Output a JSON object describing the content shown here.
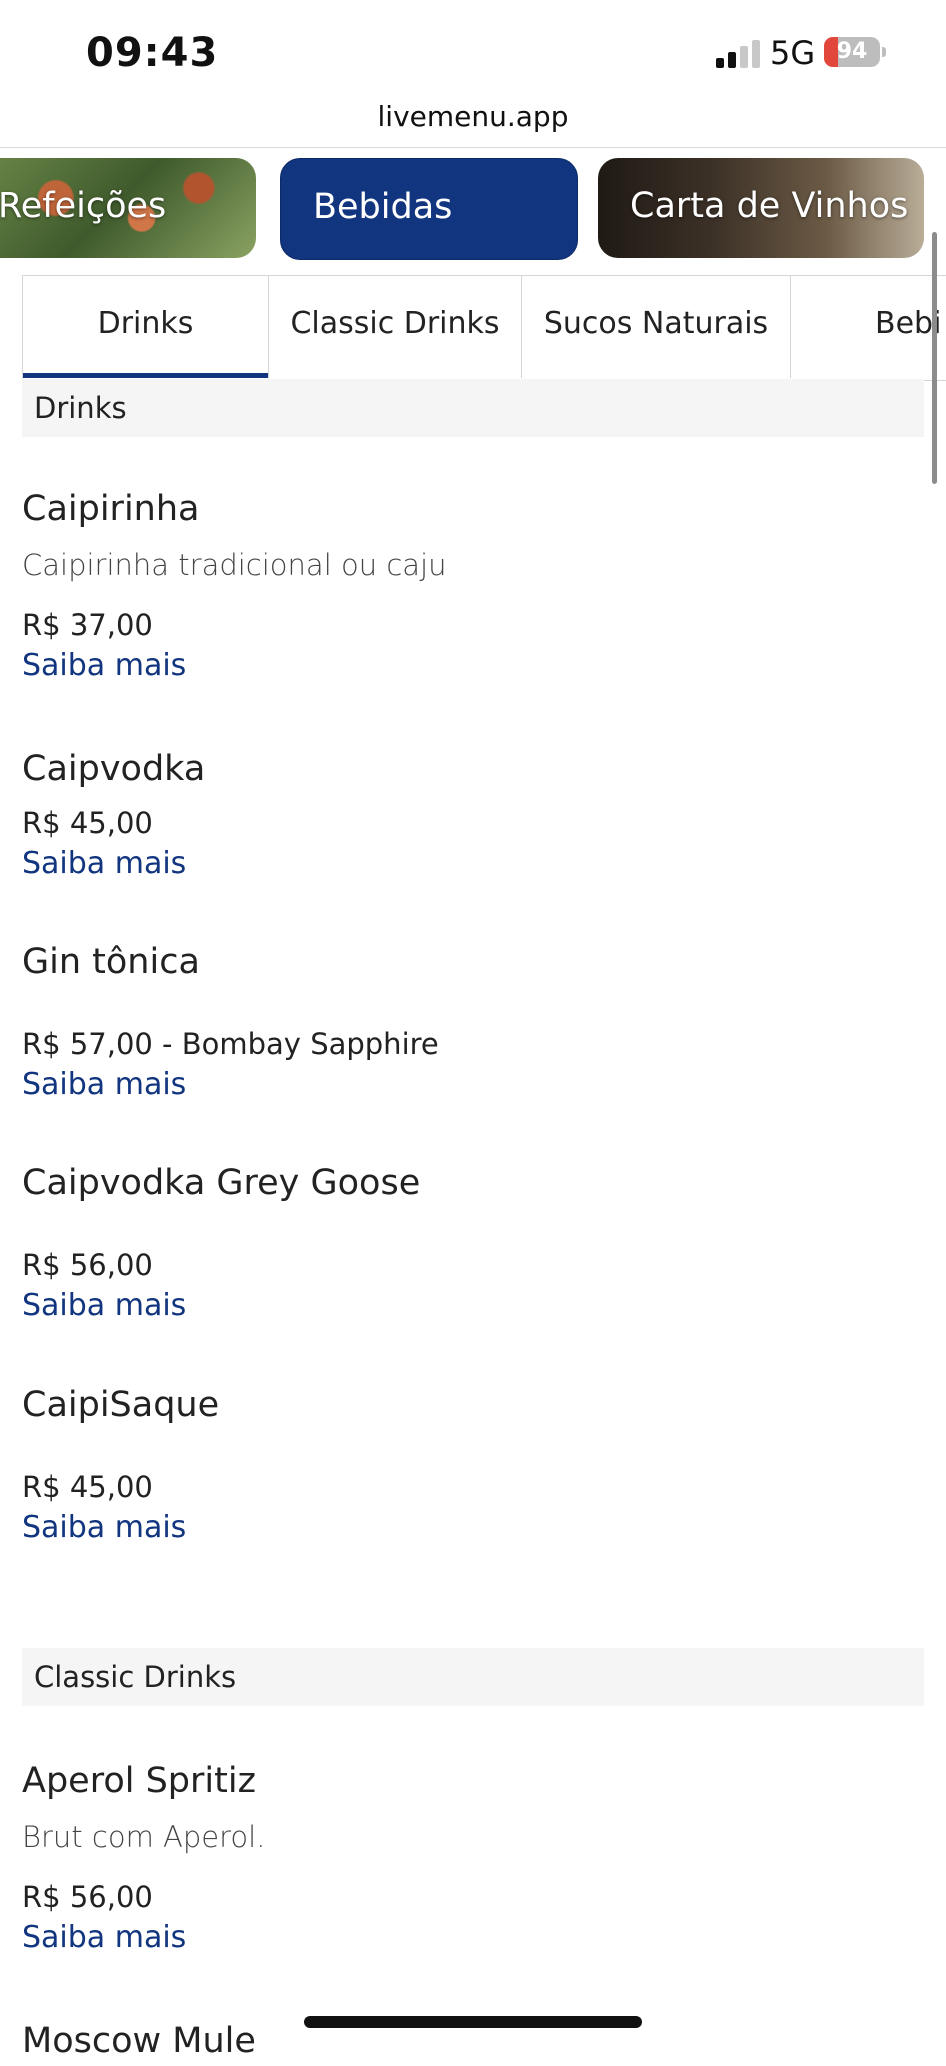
{
  "status_bar": {
    "time": "09:43",
    "network": "5G",
    "battery": "94"
  },
  "browser": {
    "url": "livemenu.app"
  },
  "categories": [
    {
      "label": "Refeições"
    },
    {
      "label": "Bebidas"
    },
    {
      "label": "Carta de Vinhos"
    }
  ],
  "tabs": [
    {
      "label": "Drinks"
    },
    {
      "label": "Classic Drinks"
    },
    {
      "label": "Sucos Naturais"
    },
    {
      "label": "Bebi"
    }
  ],
  "sections": [
    {
      "title": "Drinks",
      "items": [
        {
          "name": "Caipirinha",
          "description": "Caipirinha tradicional ou caju",
          "price": "R$ 37,00",
          "link": "Saiba mais"
        },
        {
          "name": "Caipvodka",
          "price": "R$ 45,00",
          "link": "Saiba mais"
        },
        {
          "name": "Gin tônica",
          "price": "R$ 57,00 - Bombay Sapphire",
          "link": "Saiba mais"
        },
        {
          "name": "Caipvodka Grey Goose",
          "price": "R$ 56,00",
          "link": "Saiba mais"
        },
        {
          "name": "CaipiSaque",
          "price": "R$ 45,00",
          "link": "Saiba mais"
        }
      ]
    },
    {
      "title": "Classic Drinks",
      "items": [
        {
          "name": "Aperol Spritiz",
          "description": "Brut com Aperol.",
          "price": "R$ 56,00",
          "link": "Saiba mais"
        },
        {
          "name": "Moscow Mule"
        }
      ]
    }
  ],
  "colors": {
    "accent": "#12357f",
    "battery_low": "#e2473b"
  },
  "icons": [
    "signal-icon",
    "battery-icon"
  ]
}
